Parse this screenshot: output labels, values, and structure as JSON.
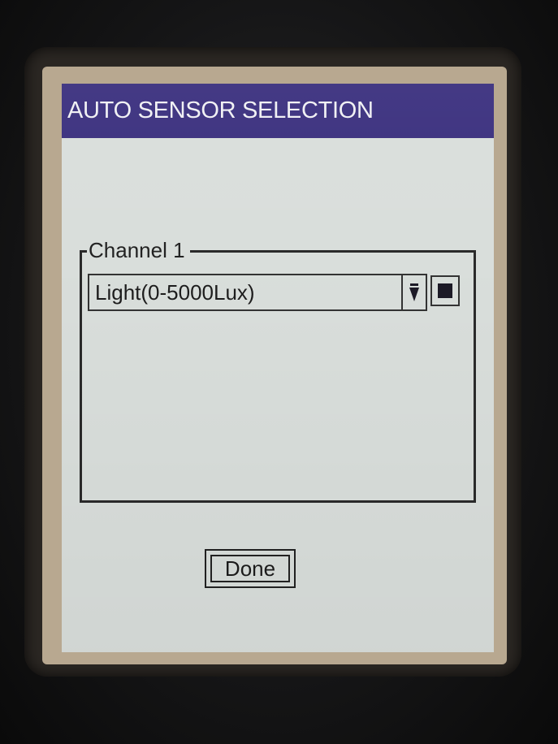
{
  "window": {
    "title": "AUTO SENSOR SELECTION"
  },
  "channel_group": {
    "label": "Channel 1",
    "sensor_select": {
      "selected_value": "Light(0-5000Lux)"
    },
    "color_indicator": {
      "color": "#1c1a26"
    }
  },
  "actions": {
    "done_label": "Done"
  },
  "colors": {
    "title_bar": "#3a2f7e",
    "screen_background": "#d9dedb"
  }
}
